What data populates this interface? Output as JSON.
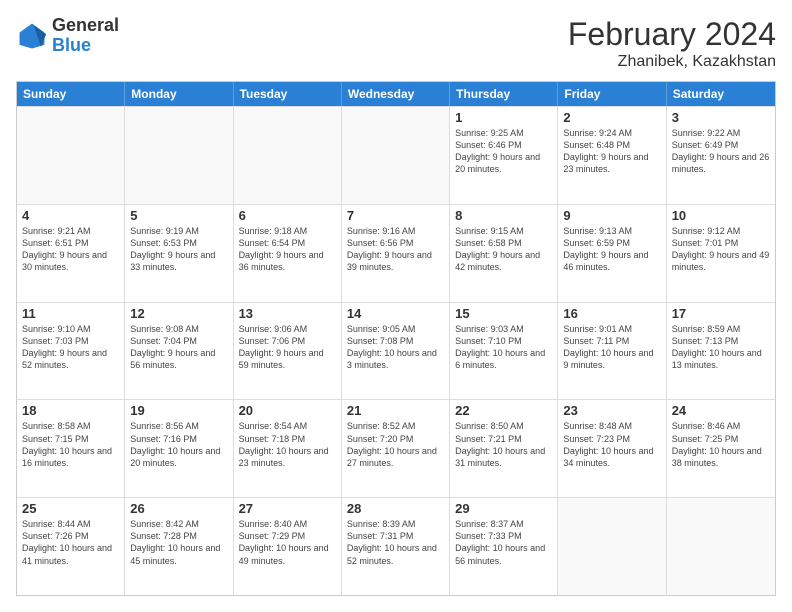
{
  "header": {
    "logo": {
      "general": "General",
      "blue": "Blue"
    },
    "title": "February 2024",
    "subtitle": "Zhanibek, Kazakhstan"
  },
  "days_of_week": [
    "Sunday",
    "Monday",
    "Tuesday",
    "Wednesday",
    "Thursday",
    "Friday",
    "Saturday"
  ],
  "weeks": [
    [
      {
        "day": "",
        "empty": true
      },
      {
        "day": "",
        "empty": true
      },
      {
        "day": "",
        "empty": true
      },
      {
        "day": "",
        "empty": true
      },
      {
        "day": "1",
        "sunrise": "9:25 AM",
        "sunset": "6:46 PM",
        "daylight": "9 hours and 20 minutes."
      },
      {
        "day": "2",
        "sunrise": "9:24 AM",
        "sunset": "6:48 PM",
        "daylight": "9 hours and 23 minutes."
      },
      {
        "day": "3",
        "sunrise": "9:22 AM",
        "sunset": "6:49 PM",
        "daylight": "9 hours and 26 minutes."
      }
    ],
    [
      {
        "day": "4",
        "sunrise": "9:21 AM",
        "sunset": "6:51 PM",
        "daylight": "9 hours and 30 minutes."
      },
      {
        "day": "5",
        "sunrise": "9:19 AM",
        "sunset": "6:53 PM",
        "daylight": "9 hours and 33 minutes."
      },
      {
        "day": "6",
        "sunrise": "9:18 AM",
        "sunset": "6:54 PM",
        "daylight": "9 hours and 36 minutes."
      },
      {
        "day": "7",
        "sunrise": "9:16 AM",
        "sunset": "6:56 PM",
        "daylight": "9 hours and 39 minutes."
      },
      {
        "day": "8",
        "sunrise": "9:15 AM",
        "sunset": "6:58 PM",
        "daylight": "9 hours and 42 minutes."
      },
      {
        "day": "9",
        "sunrise": "9:13 AM",
        "sunset": "6:59 PM",
        "daylight": "9 hours and 46 minutes."
      },
      {
        "day": "10",
        "sunrise": "9:12 AM",
        "sunset": "7:01 PM",
        "daylight": "9 hours and 49 minutes."
      }
    ],
    [
      {
        "day": "11",
        "sunrise": "9:10 AM",
        "sunset": "7:03 PM",
        "daylight": "9 hours and 52 minutes."
      },
      {
        "day": "12",
        "sunrise": "9:08 AM",
        "sunset": "7:04 PM",
        "daylight": "9 hours and 56 minutes."
      },
      {
        "day": "13",
        "sunrise": "9:06 AM",
        "sunset": "7:06 PM",
        "daylight": "9 hours and 59 minutes."
      },
      {
        "day": "14",
        "sunrise": "9:05 AM",
        "sunset": "7:08 PM",
        "daylight": "10 hours and 3 minutes."
      },
      {
        "day": "15",
        "sunrise": "9:03 AM",
        "sunset": "7:10 PM",
        "daylight": "10 hours and 6 minutes."
      },
      {
        "day": "16",
        "sunrise": "9:01 AM",
        "sunset": "7:11 PM",
        "daylight": "10 hours and 9 minutes."
      },
      {
        "day": "17",
        "sunrise": "8:59 AM",
        "sunset": "7:13 PM",
        "daylight": "10 hours and 13 minutes."
      }
    ],
    [
      {
        "day": "18",
        "sunrise": "8:58 AM",
        "sunset": "7:15 PM",
        "daylight": "10 hours and 16 minutes."
      },
      {
        "day": "19",
        "sunrise": "8:56 AM",
        "sunset": "7:16 PM",
        "daylight": "10 hours and 20 minutes."
      },
      {
        "day": "20",
        "sunrise": "8:54 AM",
        "sunset": "7:18 PM",
        "daylight": "10 hours and 23 minutes."
      },
      {
        "day": "21",
        "sunrise": "8:52 AM",
        "sunset": "7:20 PM",
        "daylight": "10 hours and 27 minutes."
      },
      {
        "day": "22",
        "sunrise": "8:50 AM",
        "sunset": "7:21 PM",
        "daylight": "10 hours and 31 minutes."
      },
      {
        "day": "23",
        "sunrise": "8:48 AM",
        "sunset": "7:23 PM",
        "daylight": "10 hours and 34 minutes."
      },
      {
        "day": "24",
        "sunrise": "8:46 AM",
        "sunset": "7:25 PM",
        "daylight": "10 hours and 38 minutes."
      }
    ],
    [
      {
        "day": "25",
        "sunrise": "8:44 AM",
        "sunset": "7:26 PM",
        "daylight": "10 hours and 41 minutes."
      },
      {
        "day": "26",
        "sunrise": "8:42 AM",
        "sunset": "7:28 PM",
        "daylight": "10 hours and 45 minutes."
      },
      {
        "day": "27",
        "sunrise": "8:40 AM",
        "sunset": "7:29 PM",
        "daylight": "10 hours and 49 minutes."
      },
      {
        "day": "28",
        "sunrise": "8:39 AM",
        "sunset": "7:31 PM",
        "daylight": "10 hours and 52 minutes."
      },
      {
        "day": "29",
        "sunrise": "8:37 AM",
        "sunset": "7:33 PM",
        "daylight": "10 hours and 56 minutes."
      },
      {
        "day": "",
        "empty": true
      },
      {
        "day": "",
        "empty": true
      }
    ]
  ]
}
